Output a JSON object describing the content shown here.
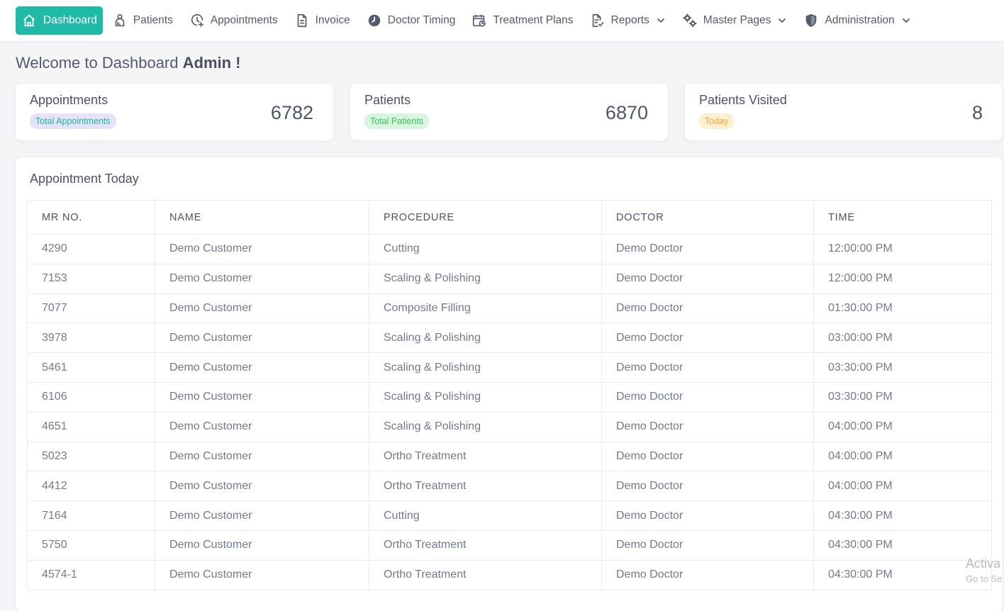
{
  "nav": {
    "items": [
      {
        "label": "Dashboard",
        "icon": "home-icon",
        "active": true
      },
      {
        "label": "Patients",
        "icon": "patient-icon"
      },
      {
        "label": "Appointments",
        "icon": "clock-plus-icon"
      },
      {
        "label": "Invoice",
        "icon": "document-icon"
      },
      {
        "label": "Doctor Timing",
        "icon": "clock-icon"
      },
      {
        "label": "Treatment Plans",
        "icon": "calendar-clock-icon"
      },
      {
        "label": "Reports",
        "icon": "report-icon",
        "dropdown": true
      },
      {
        "label": "Master Pages",
        "icon": "gears-icon",
        "dropdown": true
      },
      {
        "label": "Administration",
        "icon": "shield-icon",
        "dropdown": true
      }
    ]
  },
  "welcome": {
    "prefix": "Welcome to Dashboard",
    "user": "Admin !"
  },
  "cards": [
    {
      "title": "Appointments",
      "badge": "Total Appointments",
      "value": "6782"
    },
    {
      "title": "Patients",
      "badge": "Total Patients",
      "value": "6870"
    },
    {
      "title": "Patients Visited",
      "badge": "Today",
      "value": "8"
    }
  ],
  "appointments": {
    "title": "Appointment Today",
    "columns": [
      "MR NO.",
      "NAME",
      "PROCEDURE",
      "DOCTOR",
      "TIME"
    ],
    "rows": [
      [
        "4290",
        "Demo Customer",
        "Cutting",
        "Demo Doctor",
        "12:00:00 PM"
      ],
      [
        "7153",
        "Demo Customer",
        "Scaling & Polishing",
        "Demo Doctor",
        "12:00:00 PM"
      ],
      [
        "7077",
        "Demo Customer",
        "Composite Filling",
        "Demo Doctor",
        "01:30:00 PM"
      ],
      [
        "3978",
        "Demo Customer",
        "Scaling & Polishing",
        "Demo Doctor",
        "03:00:00 PM"
      ],
      [
        "5461",
        "Demo Customer",
        "Scaling & Polishing",
        "Demo Doctor",
        "03:30:00 PM"
      ],
      [
        "6106",
        "Demo Customer",
        "Scaling & Polishing",
        "Demo Doctor",
        "03:30:00 PM"
      ],
      [
        "4651",
        "Demo Customer",
        "Scaling & Polishing",
        "Demo Doctor",
        "04:00:00 PM"
      ],
      [
        "5023",
        "Demo Customer",
        "Ortho Treatment",
        "Demo Doctor",
        "04:00:00 PM"
      ],
      [
        "4412",
        "Demo Customer",
        "Ortho Treatment",
        "Demo Doctor",
        "04:00:00 PM"
      ],
      [
        "7164",
        "Demo Customer",
        "Cutting",
        "Demo Doctor",
        "04:30:00 PM"
      ],
      [
        "5750",
        "Demo Customer",
        "Ortho Treatment",
        "Demo Doctor",
        "04:30:00 PM"
      ],
      [
        "4574-1",
        "Demo Customer",
        "Ortho Treatment",
        "Demo Doctor",
        "04:30:00 PM"
      ]
    ]
  },
  "watermark": {
    "line1": "Activa",
    "line2": "Go to Se"
  },
  "colors": {
    "accent": "#1fbaa7",
    "page_bg": "#f5f5f8",
    "text": "#545a6d"
  }
}
